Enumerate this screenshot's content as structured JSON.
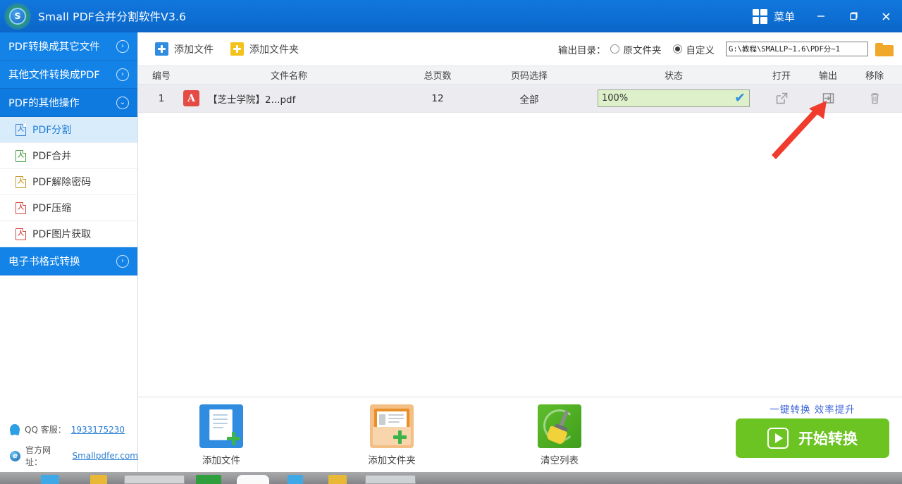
{
  "titlebar": {
    "title": "Small  PDF合并分割软件V3.6",
    "logo_letter": "S",
    "menu_label": "菜单",
    "minimize_tooltip": "最小化",
    "maximize_tooltip": "最大化",
    "close_tooltip": "关闭"
  },
  "sidebar": {
    "groups": [
      {
        "label": "PDF转换成其它文件",
        "expanded": false,
        "chevron": "›"
      },
      {
        "label": "其他文件转换成PDF",
        "expanded": false,
        "chevron": "›"
      },
      {
        "label": "PDF的其他操作",
        "expanded": true,
        "chevron": "⌄"
      }
    ],
    "items": [
      {
        "label": "PDF分割",
        "active": true,
        "icon_color": "#3f86d6"
      },
      {
        "label": "PDF合并",
        "active": false,
        "icon_color": "#4a9e45"
      },
      {
        "label": "PDF解除密码",
        "active": false,
        "icon_color": "#c79a2b"
      },
      {
        "label": "PDF压缩",
        "active": false,
        "icon_color": "#d04a45"
      },
      {
        "label": "PDF图片获取",
        "active": false,
        "icon_color": "#d04a45"
      }
    ],
    "group_last": {
      "label": "电子书格式转换",
      "expanded": false,
      "chevron": "›"
    },
    "footer": {
      "qq_label": "QQ 客服：",
      "qq_value": "1933175230",
      "site_label": "官方网址：",
      "site_value": "Smallpdfer.com"
    }
  },
  "toolbar": {
    "add_file_label": "添加文件",
    "add_folder_label": "添加文件夹",
    "outdir_label": "输出目录：",
    "option_original": "原文件夹",
    "option_custom": "自定义",
    "selected_option": "自定义",
    "path_value": "G:\\教程\\SMALLP~1.6\\PDF分~1",
    "browse_tooltip": "浏览"
  },
  "table": {
    "headers": [
      "编号",
      "文件名称",
      "总页数",
      "页码选择",
      "状态",
      "打开",
      "输出",
      "移除"
    ],
    "rows": [
      {
        "num": "1",
        "filename": "【芝士学院】2...pdf",
        "file_badge": "A",
        "pages": "12",
        "page_selection": "全部",
        "status": "100%",
        "status_done": "✔",
        "open_tooltip": "打开",
        "output_tooltip": "输出",
        "delete_tooltip": "移除"
      }
    ]
  },
  "bottom": {
    "actions": [
      {
        "label": "添加文件",
        "icon": "add-file-icon"
      },
      {
        "label": "添加文件夹",
        "icon": "add-folder-icon"
      },
      {
        "label": "清空列表",
        "icon": "clear-list-icon"
      }
    ],
    "cta_tagline": "一键转换  效率提升",
    "cta_label": "开始转换"
  },
  "colors": {
    "brand_blue": "#1383e8",
    "accent_green": "#6cc423",
    "progress_bg": "#ddf0c9",
    "annotation_red": "#f03b2d"
  }
}
